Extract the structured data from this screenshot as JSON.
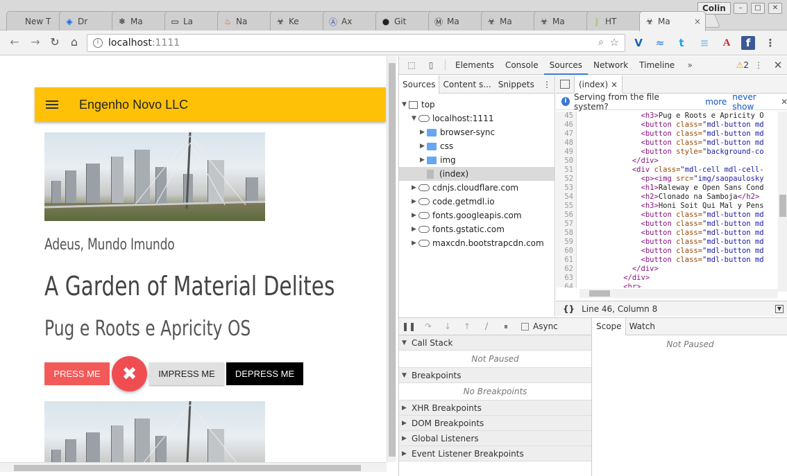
{
  "browser": {
    "profile_name": "Colin",
    "tabs": [
      {
        "label": "New T",
        "icon": "blank-icon"
      },
      {
        "label": "Dr",
        "icon": "dropbox-icon"
      },
      {
        "label": "Ma",
        "icon": "snowflake-icon"
      },
      {
        "label": "La",
        "icon": "page-icon"
      },
      {
        "label": "Na",
        "icon": "flame-icon"
      },
      {
        "label": "Ke",
        "icon": "biohazard-icon"
      },
      {
        "label": "Ax",
        "icon": "a-circle-icon"
      },
      {
        "label": "Git",
        "icon": "github-icon"
      },
      {
        "label": "Ma",
        "icon": "m-circle-icon"
      },
      {
        "label": "Ma",
        "icon": "biohazard-icon"
      },
      {
        "label": "Ma",
        "icon": "biohazard-icon"
      },
      {
        "label": "HT",
        "icon": "j-icon"
      },
      {
        "label": "Ma",
        "icon": "biohazard-icon"
      }
    ],
    "url_host": "localhost",
    "url_port": ":1111"
  },
  "page": {
    "app_title": "Engenho Novo LLC",
    "subtitle": "Adeus, Mundo Imundo",
    "heading": "A Garden of Material Delites",
    "subheading": "Pug e Roots e Apricity OS",
    "buttons": {
      "press": "Press Me",
      "fab_symbol": "✖",
      "impress": "Impress Me",
      "depress": "Depress Me"
    }
  },
  "devtools": {
    "tabs": [
      "Elements",
      "Console",
      "Sources",
      "Network",
      "Timeline"
    ],
    "active_tab": "Sources",
    "warning_count": "2",
    "navigator_tabs": [
      "Sources",
      "Content s...",
      "Snippets"
    ],
    "tree": [
      {
        "label": "top",
        "type": "frame",
        "expanded": true
      },
      {
        "label": "localhost:1111",
        "type": "cloud",
        "expanded": true
      },
      {
        "label": "browser-sync",
        "type": "folder"
      },
      {
        "label": "css",
        "type": "folder"
      },
      {
        "label": "img",
        "type": "folder"
      },
      {
        "label": "(index)",
        "type": "file",
        "selected": true
      },
      {
        "label": "cdnjs.cloudflare.com",
        "type": "cloud"
      },
      {
        "label": "code.getmdl.io",
        "type": "cloud"
      },
      {
        "label": "fonts.googleapis.com",
        "type": "cloud"
      },
      {
        "label": "fonts.gstatic.com",
        "type": "cloud"
      },
      {
        "label": "maxcdn.bootstrapcdn.com",
        "type": "cloud"
      }
    ],
    "editor_tab": "(index)",
    "infobar": {
      "text": "Serving from the file system?",
      "more": "more",
      "never": "never show"
    },
    "code_lines": [
      {
        "n": "45",
        "indent": 14,
        "tag": "<h3>",
        "rest": "Pug e Roots e Apricity O"
      },
      {
        "n": "46",
        "indent": 14,
        "tag": "<button",
        "attr": " class=",
        "val": "\"mdl-button md"
      },
      {
        "n": "47",
        "indent": 14,
        "tag": "<button",
        "attr": " class=",
        "val": "\"mdl-button md"
      },
      {
        "n": "48",
        "indent": 14,
        "tag": "<button",
        "attr": " class=",
        "val": "\"mdl-button md"
      },
      {
        "n": "49",
        "indent": 14,
        "tag": "<button",
        "attr": " style=",
        "val": "\"background-co"
      },
      {
        "n": "50",
        "indent": 12,
        "tag": "</div>",
        "rest": ""
      },
      {
        "n": "51",
        "indent": 12,
        "tag": "<div",
        "attr": " class=",
        "val": "\"mdl-cell mdl-cell-"
      },
      {
        "n": "52",
        "indent": 14,
        "tag": "<p><img",
        "attr": " src=",
        "val": "\"img/saopaulosky"
      },
      {
        "n": "53",
        "indent": 14,
        "tag": "<h1>",
        "rest": "Raleway e Open Sans Cond"
      },
      {
        "n": "54",
        "indent": 14,
        "tag": "<h2>",
        "rest": "Clonado na Samboja",
        "close": "</h2>"
      },
      {
        "n": "55",
        "indent": 14,
        "tag": "<h3>",
        "rest": "Honi Soit Qui Mal y Pens"
      },
      {
        "n": "56",
        "indent": 14,
        "tag": "<button",
        "attr": " class=",
        "val": "\"mdl-button md"
      },
      {
        "n": "57",
        "indent": 14,
        "tag": "<button",
        "attr": " class=",
        "val": "\"mdl-button md"
      },
      {
        "n": "58",
        "indent": 14,
        "tag": "<button",
        "attr": " class=",
        "val": "\"mdl-button md"
      },
      {
        "n": "59",
        "indent": 14,
        "tag": "<button",
        "attr": " class=",
        "val": "\"mdl-button md"
      },
      {
        "n": "60",
        "indent": 14,
        "tag": "<button",
        "attr": " class=",
        "val": "\"mdl-button md"
      },
      {
        "n": "61",
        "indent": 14,
        "tag": "<button",
        "attr": " class=",
        "val": "\"mdl-button md"
      },
      {
        "n": "62",
        "indent": 12,
        "tag": "</div>",
        "rest": ""
      },
      {
        "n": "63",
        "indent": 10,
        "tag": "</div>",
        "rest": ""
      },
      {
        "n": "64",
        "indent": 10,
        "tag": "<hr>",
        "rest": ""
      }
    ],
    "cursor_status": "Line 46, Column 8",
    "async_label": "Async",
    "sections": [
      {
        "label": "Call Stack",
        "expanded": true,
        "body": "Not Paused"
      },
      {
        "label": "Breakpoints",
        "expanded": true,
        "body": "No Breakpoints"
      },
      {
        "label": "XHR Breakpoints",
        "expanded": false
      },
      {
        "label": "DOM Breakpoints",
        "expanded": false
      },
      {
        "label": "Global Listeners",
        "expanded": false
      },
      {
        "label": "Event Listener Breakpoints",
        "expanded": false
      }
    ],
    "scope_tabs": [
      "Scope",
      "Watch"
    ],
    "scope_body": "Not Paused"
  },
  "colors": {
    "app_bar": "#ffc107",
    "accent_button": "#f25959",
    "devtools_blue": "#3879d9"
  }
}
